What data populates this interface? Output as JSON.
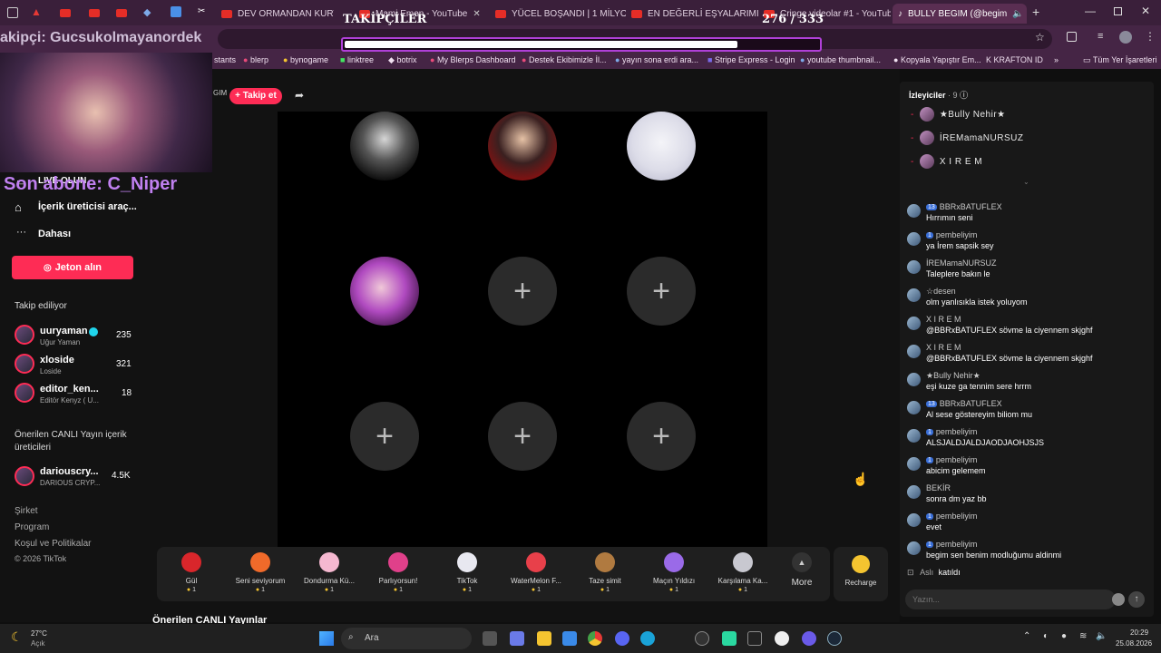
{
  "browser": {
    "tabs": [
      {
        "label": "DEV ORMANDAN KURTULU"
      },
      {
        "label": "Mami Emen - YouTube"
      },
      {
        "label": "YÜCEL BOŞANDI | 1 MİLYON"
      },
      {
        "label": "EN DEĞERLİ EŞYALARIMIZI K"
      },
      {
        "label": "Cringe videolar #1 - YouTub"
      },
      {
        "label": "BULLY BEGIM (@begim"
      }
    ],
    "bookmarks": [
      "stants",
      "blerp",
      "bynogame",
      "linktree",
      "botrix",
      "My Blerps Dashboard",
      "Destek Ekibimizle İl...",
      "yayın sona erdi ara...",
      "Stripe Express - Login",
      "youtube thumbnail...",
      "Kopyala Yapıştır Em...",
      "KRAFTON ID",
      "Tüm Yer İşaretleri"
    ]
  },
  "overlay": {
    "followers_title": "TAKİPÇİLER",
    "followers_count": "276 / 333",
    "followers_progress": 0.83,
    "ticker_text": "akipçi: Gucsukolmayanordek",
    "last_sub": "Son abone: C_Niper"
  },
  "stream": {
    "host_partial": "GIM",
    "follow_label": "+ Takip et"
  },
  "sidebar": {
    "live_label": "LIVE OLUN",
    "creator_tools": "İçerik üreticisi araç...",
    "more": "Dahası",
    "coins_button": "Jeton alın",
    "following_header": "Takip ediliyor",
    "following": [
      {
        "name": "uuryaman",
        "sub": "Uğur Yaman",
        "count": "235"
      },
      {
        "name": "xloside",
        "sub": "Loside",
        "count": "321"
      },
      {
        "name": "editor_ken...",
        "sub": "Editör Kenyz ( U...",
        "count": "18"
      }
    ],
    "suggested_header": "Önerilen CANLI Yayın içerik üreticileri",
    "suggested": [
      {
        "name": "dariouscry...",
        "sub": "DARIOUS CRYP...",
        "count": "4.5K"
      }
    ],
    "footer": [
      "Şirket",
      "Program",
      "Koşul ve Politikalar",
      "© 2026 TikTok"
    ]
  },
  "gifts": [
    {
      "name": "Gül",
      "cost": "1"
    },
    {
      "name": "Seni seviyorum",
      "cost": "1"
    },
    {
      "name": "Dondurma Kü...",
      "cost": "1"
    },
    {
      "name": "Parlıyorsun!",
      "cost": "1"
    },
    {
      "name": "TikTok",
      "cost": "1"
    },
    {
      "name": "WaterMelon F...",
      "cost": "1"
    },
    {
      "name": "Taze simit",
      "cost": "1"
    },
    {
      "name": "Maçın Yıldızı",
      "cost": "1"
    },
    {
      "name": "Karşılama Ka...",
      "cost": "1"
    }
  ],
  "gift_more": "More",
  "recharge": "Recharge",
  "suggested_live_heading": "Önerilen CANLI Yayınlar",
  "chat": {
    "viewers_label": "İzleyiciler",
    "viewers_count": "· 9",
    "viewers": [
      "★Bully Nehir★",
      "İREMamaNURSUZ",
      "X I R E M"
    ],
    "messages": [
      {
        "user": "BBRxBATUFLEX",
        "level": "13",
        "text": "Hırrımın seni"
      },
      {
        "user": "pembeliyim",
        "level": "1",
        "text": "ya İrem sapsik sey"
      },
      {
        "user": "İREMamaNURSUZ",
        "level": "",
        "text": "Taleplere bakın le"
      },
      {
        "user": "☆desen",
        "level": "",
        "text": "olm yanlısıkla istek yoluyom"
      },
      {
        "user": "X I R E M",
        "level": "",
        "text": "@BBRxBATUFLEX sövme la ciyennem skjghf"
      },
      {
        "user": "X I R E M",
        "level": "",
        "text": "@BBRxBATUFLEX sövme la ciyennem skjghf"
      },
      {
        "user": "★Bully Nehir★",
        "level": "",
        "text": "eşi kuze ga tennim sere hrrm"
      },
      {
        "user": "BBRxBATUFLEX",
        "level": "13",
        "text": "Al sese göstereyim biliom mu"
      },
      {
        "user": "pembeliyim",
        "level": "1",
        "text": "ALSJALDJALDJAODJAOHJSJS"
      },
      {
        "user": "pembeliyim",
        "level": "1",
        "text": "abicim gelemem"
      },
      {
        "user": "BEKİR",
        "level": "",
        "text": "sonra dm yaz bb"
      },
      {
        "user": "pembeliyim",
        "level": "1",
        "text": "evet"
      },
      {
        "user": "pembeliyim",
        "level": "1",
        "text": "begim sen benim modluğumu aldinmi"
      }
    ],
    "join_user": "Aslı",
    "join_text": "katıldı",
    "input_placeholder": "Yazın..."
  },
  "taskbar": {
    "weather_temp": "27°C",
    "weather_desc": "Açık",
    "search_placeholder": "Ara",
    "time": "20:29",
    "date": "25.08.2026"
  }
}
